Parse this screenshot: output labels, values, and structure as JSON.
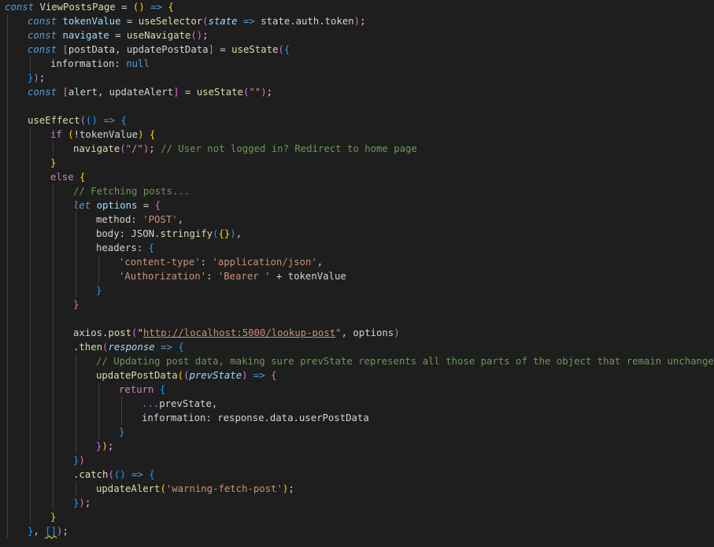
{
  "colors": {
    "background": "#1e1e1e",
    "keyword": "#569cd6",
    "control": "#c586c0",
    "function": "#dcdcaa",
    "variable": "#9cdcfe",
    "identifier": "#d4d4d4",
    "string": "#ce9178",
    "comment": "#6a9955",
    "bracket_yellow": "#ffd700",
    "bracket_pink": "#da70d6",
    "bracket_blue": "#179fff",
    "indent_guide": "#404040"
  },
  "code": {
    "lines": [
      {
        "indent": 0,
        "tokens": [
          {
            "t": "const",
            "c": "keyword",
            "i": true
          },
          {
            "t": " "
          },
          {
            "t": "ViewPostsPage",
            "c": "function"
          },
          {
            "t": " = "
          },
          {
            "t": "(",
            "c": "bracket_yellow"
          },
          {
            "t": ")",
            "c": "bracket_yellow"
          },
          {
            "t": " "
          },
          {
            "t": "=>",
            "c": "keyword"
          },
          {
            "t": " "
          },
          {
            "t": "{",
            "c": "bracket_yellow"
          }
        ]
      },
      {
        "indent": 1,
        "tokens": [
          {
            "t": "const",
            "c": "keyword",
            "i": true
          },
          {
            "t": " "
          },
          {
            "t": "tokenValue",
            "c": "variable"
          },
          {
            "t": " = "
          },
          {
            "t": "useSelector",
            "c": "function"
          },
          {
            "t": "(",
            "c": "bracket_pink"
          },
          {
            "t": "state",
            "c": "variable",
            "i": true
          },
          {
            "t": " "
          },
          {
            "t": "=>",
            "c": "keyword"
          },
          {
            "t": " state.auth.token"
          },
          {
            "t": ")",
            "c": "bracket_pink"
          },
          {
            "t": ";"
          }
        ]
      },
      {
        "indent": 1,
        "tokens": [
          {
            "t": "const",
            "c": "keyword",
            "i": true
          },
          {
            "t": " "
          },
          {
            "t": "navigate",
            "c": "variable"
          },
          {
            "t": " = "
          },
          {
            "t": "useNavigate",
            "c": "function"
          },
          {
            "t": "()",
            "c": "bracket_pink"
          },
          {
            "t": ";"
          }
        ]
      },
      {
        "indent": 1,
        "tokens": [
          {
            "t": "const",
            "c": "keyword",
            "i": true
          },
          {
            "t": " "
          },
          {
            "t": "[",
            "c": "bracket_pink"
          },
          {
            "t": "postData, updatePostData"
          },
          {
            "t": "]",
            "c": "bracket_pink"
          },
          {
            "t": " = "
          },
          {
            "t": "useState",
            "c": "function"
          },
          {
            "t": "(",
            "c": "bracket_pink"
          },
          {
            "t": "{",
            "c": "bracket_blue"
          }
        ]
      },
      {
        "indent": 2,
        "tokens": [
          {
            "t": "information: "
          },
          {
            "t": "null",
            "c": "keyword"
          }
        ]
      },
      {
        "indent": 1,
        "tokens": [
          {
            "t": "}",
            "c": "bracket_blue"
          },
          {
            "t": ")",
            "c": "bracket_pink"
          },
          {
            "t": ";"
          }
        ]
      },
      {
        "indent": 1,
        "tokens": [
          {
            "t": "const",
            "c": "keyword",
            "i": true
          },
          {
            "t": " "
          },
          {
            "t": "[",
            "c": "bracket_pink"
          },
          {
            "t": "alert, updateAlert"
          },
          {
            "t": "]",
            "c": "bracket_pink"
          },
          {
            "t": " = "
          },
          {
            "t": "useState",
            "c": "function"
          },
          {
            "t": "(",
            "c": "bracket_pink"
          },
          {
            "t": "\"\"",
            "c": "string"
          },
          {
            "t": ")",
            "c": "bracket_pink"
          },
          {
            "t": ";"
          }
        ]
      },
      {
        "indent": 1,
        "tokens": []
      },
      {
        "indent": 1,
        "tokens": [
          {
            "t": "useEffect",
            "c": "function"
          },
          {
            "t": "(",
            "c": "bracket_pink"
          },
          {
            "t": "()",
            "c": "bracket_blue"
          },
          {
            "t": " "
          },
          {
            "t": "=>",
            "c": "keyword"
          },
          {
            "t": " "
          },
          {
            "t": "{",
            "c": "bracket_blue"
          }
        ]
      },
      {
        "indent": 2,
        "tokens": [
          {
            "t": "if",
            "c": "control"
          },
          {
            "t": " "
          },
          {
            "t": "(",
            "c": "bracket_yellow"
          },
          {
            "t": "!",
            "c": "identifier"
          },
          {
            "t": "tokenValue"
          },
          {
            "t": ")",
            "c": "bracket_yellow"
          },
          {
            "t": " "
          },
          {
            "t": "{",
            "c": "bracket_yellow"
          }
        ]
      },
      {
        "indent": 3,
        "tokens": [
          {
            "t": "navigate",
            "c": "function"
          },
          {
            "t": "(",
            "c": "bracket_pink"
          },
          {
            "t": "\"/\"",
            "c": "string"
          },
          {
            "t": ")",
            "c": "bracket_pink"
          },
          {
            "t": "; "
          },
          {
            "t": "// User not logged in? Redirect to home page",
            "c": "comment"
          }
        ]
      },
      {
        "indent": 2,
        "tokens": [
          {
            "t": "}",
            "c": "bracket_yellow"
          }
        ]
      },
      {
        "indent": 2,
        "tokens": [
          {
            "t": "else",
            "c": "control"
          },
          {
            "t": " "
          },
          {
            "t": "{",
            "c": "bracket_yellow"
          }
        ]
      },
      {
        "indent": 3,
        "tokens": [
          {
            "t": "// Fetching posts...",
            "c": "comment"
          }
        ]
      },
      {
        "indent": 3,
        "tokens": [
          {
            "t": "let",
            "c": "keyword",
            "i": true
          },
          {
            "t": " "
          },
          {
            "t": "options",
            "c": "variable"
          },
          {
            "t": " = "
          },
          {
            "t": "{",
            "c": "bracket_pink"
          }
        ]
      },
      {
        "indent": 4,
        "tokens": [
          {
            "t": "method: "
          },
          {
            "t": "'POST'",
            "c": "string"
          },
          {
            "t": ","
          }
        ]
      },
      {
        "indent": 4,
        "tokens": [
          {
            "t": "body: JSON."
          },
          {
            "t": "stringify",
            "c": "function"
          },
          {
            "t": "(",
            "c": "bracket_blue"
          },
          {
            "t": "{}",
            "c": "bracket_yellow"
          },
          {
            "t": ")",
            "c": "bracket_blue"
          },
          {
            "t": ","
          }
        ]
      },
      {
        "indent": 4,
        "tokens": [
          {
            "t": "headers: "
          },
          {
            "t": "{",
            "c": "bracket_blue"
          }
        ]
      },
      {
        "indent": 5,
        "tokens": [
          {
            "t": "'content-type'",
            "c": "string"
          },
          {
            "t": ": "
          },
          {
            "t": "'application/json'",
            "c": "string"
          },
          {
            "t": ","
          }
        ]
      },
      {
        "indent": 5,
        "tokens": [
          {
            "t": "'Authorization'",
            "c": "string"
          },
          {
            "t": ": "
          },
          {
            "t": "'Bearer '",
            "c": "string"
          },
          {
            "t": " + tokenValue"
          }
        ]
      },
      {
        "indent": 4,
        "tokens": [
          {
            "t": "}",
            "c": "bracket_blue"
          }
        ]
      },
      {
        "indent": 3,
        "tokens": [
          {
            "t": "}",
            "c": "bracket_pink"
          }
        ]
      },
      {
        "indent": 3,
        "tokens": []
      },
      {
        "indent": 3,
        "tokens": [
          {
            "t": "axios."
          },
          {
            "t": "post",
            "c": "function"
          },
          {
            "t": "(",
            "c": "bracket_pink"
          },
          {
            "t": "\""
          },
          {
            "t": "http://localhost:5000/lookup-post",
            "c": "string",
            "u": "link"
          },
          {
            "t": "\"",
            "c": "string"
          },
          {
            "t": ", options"
          },
          {
            "t": ")",
            "c": "bracket_pink"
          }
        ]
      },
      {
        "indent": 3,
        "tokens": [
          {
            "t": "."
          },
          {
            "t": "then",
            "c": "function"
          },
          {
            "t": "(",
            "c": "bracket_pink"
          },
          {
            "t": "response",
            "c": "variable",
            "i": true
          },
          {
            "t": " "
          },
          {
            "t": "=>",
            "c": "keyword"
          },
          {
            "t": " "
          },
          {
            "t": "{",
            "c": "bracket_blue"
          }
        ]
      },
      {
        "indent": 4,
        "tokens": [
          {
            "t": "// Updating post data, making sure prevState represents all those parts of the object that remain unchanged",
            "c": "comment"
          }
        ]
      },
      {
        "indent": 4,
        "tokens": [
          {
            "t": "updatePostData",
            "c": "function"
          },
          {
            "t": "(",
            "c": "bracket_yellow"
          },
          {
            "t": "(",
            "c": "bracket_pink"
          },
          {
            "t": "prevState",
            "c": "variable",
            "i": true
          },
          {
            "t": ")",
            "c": "bracket_pink"
          },
          {
            "t": " "
          },
          {
            "t": "=>",
            "c": "keyword"
          },
          {
            "t": " "
          },
          {
            "t": "{",
            "c": "bracket_pink"
          }
        ]
      },
      {
        "indent": 5,
        "tokens": [
          {
            "t": "return",
            "c": "control"
          },
          {
            "t": " "
          },
          {
            "t": "{",
            "c": "bracket_blue"
          }
        ]
      },
      {
        "indent": 6,
        "tokens": [
          {
            "t": "...",
            "c": "keyword"
          },
          {
            "t": "prevState,"
          }
        ]
      },
      {
        "indent": 6,
        "tokens": [
          {
            "t": "information: response.data.userPostData"
          }
        ]
      },
      {
        "indent": 5,
        "tokens": [
          {
            "t": "}",
            "c": "bracket_blue"
          }
        ]
      },
      {
        "indent": 4,
        "tokens": [
          {
            "t": "}",
            "c": "bracket_pink"
          },
          {
            "t": ")",
            "c": "bracket_yellow"
          },
          {
            "t": ";"
          }
        ]
      },
      {
        "indent": 3,
        "tokens": [
          {
            "t": "}",
            "c": "bracket_blue"
          },
          {
            "t": ")",
            "c": "bracket_pink"
          }
        ]
      },
      {
        "indent": 3,
        "tokens": [
          {
            "t": "."
          },
          {
            "t": "catch",
            "c": "function"
          },
          {
            "t": "(",
            "c": "bracket_pink"
          },
          {
            "t": "()",
            "c": "bracket_blue"
          },
          {
            "t": " "
          },
          {
            "t": "=>",
            "c": "keyword"
          },
          {
            "t": " "
          },
          {
            "t": "{",
            "c": "bracket_blue"
          }
        ]
      },
      {
        "indent": 4,
        "tokens": [
          {
            "t": "updateAlert",
            "c": "function"
          },
          {
            "t": "(",
            "c": "bracket_yellow"
          },
          {
            "t": "'warning-fetch-post'",
            "c": "string"
          },
          {
            "t": ")",
            "c": "bracket_yellow"
          },
          {
            "t": ";"
          }
        ]
      },
      {
        "indent": 3,
        "tokens": [
          {
            "t": "}",
            "c": "bracket_blue"
          },
          {
            "t": ")",
            "c": "bracket_pink"
          },
          {
            "t": ";"
          }
        ]
      },
      {
        "indent": 2,
        "tokens": [
          {
            "t": "}",
            "c": "bracket_yellow"
          }
        ]
      },
      {
        "indent": 1,
        "tokens": [
          {
            "t": "}",
            "c": "bracket_blue"
          },
          {
            "t": ", "
          },
          {
            "t": "[]",
            "c": "bracket_blue",
            "u": "warn"
          },
          {
            "t": ")",
            "c": "bracket_pink"
          },
          {
            "t": ";"
          }
        ]
      }
    ]
  }
}
